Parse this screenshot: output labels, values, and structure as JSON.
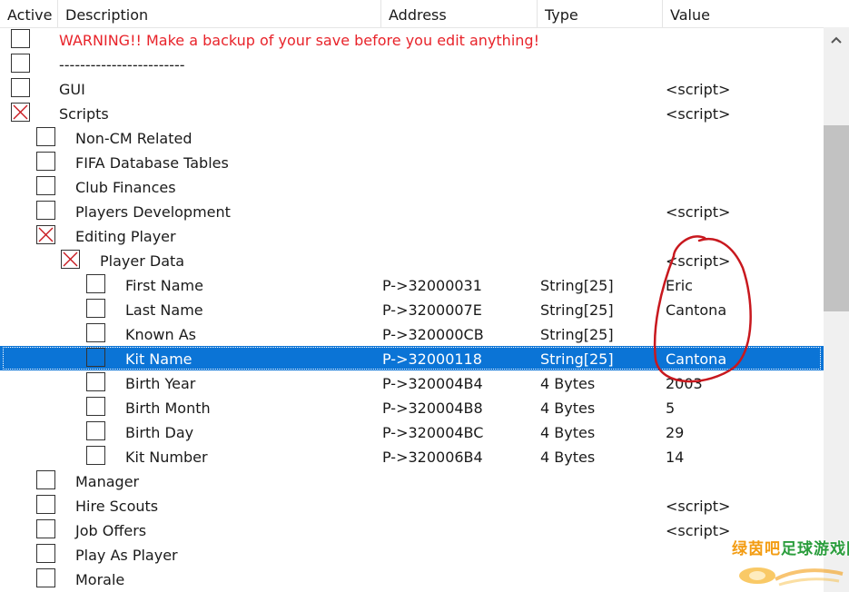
{
  "columns": {
    "active": "Active",
    "description": "Description",
    "address": "Address",
    "type": "Type",
    "value": "Value"
  },
  "rows": [
    {
      "indent": 0,
      "checked": false,
      "desc": "WARNING!! Make a backup of your save before you edit anything!",
      "warning": true,
      "address": "",
      "type": "",
      "value": ""
    },
    {
      "indent": 0,
      "checked": false,
      "desc": "------------------------",
      "address": "",
      "type": "",
      "value": ""
    },
    {
      "indent": 0,
      "checked": false,
      "desc": "GUI",
      "address": "",
      "type": "",
      "value": "<script>"
    },
    {
      "indent": 0,
      "checked": true,
      "desc": "Scripts",
      "address": "",
      "type": "",
      "value": "<script>"
    },
    {
      "indent": 1,
      "checked": false,
      "desc": "Non-CM Related",
      "address": "",
      "type": "",
      "value": ""
    },
    {
      "indent": 1,
      "checked": false,
      "desc": "FIFA Database Tables",
      "address": "",
      "type": "",
      "value": ""
    },
    {
      "indent": 1,
      "checked": false,
      "desc": "Club Finances",
      "address": "",
      "type": "",
      "value": ""
    },
    {
      "indent": 1,
      "checked": false,
      "desc": "Players Development",
      "address": "",
      "type": "",
      "value": "<script>"
    },
    {
      "indent": 1,
      "checked": true,
      "desc": "Editing Player",
      "address": "",
      "type": "",
      "value": ""
    },
    {
      "indent": 2,
      "checked": true,
      "desc": "Player Data",
      "address": "",
      "type": "",
      "value": "<script>"
    },
    {
      "indent": 3,
      "checked": false,
      "desc": "First Name",
      "address": "P->32000031",
      "type": "String[25]",
      "value": "Eric"
    },
    {
      "indent": 3,
      "checked": false,
      "desc": "Last Name",
      "address": "P->3200007E",
      "type": "String[25]",
      "value": "Cantona"
    },
    {
      "indent": 3,
      "checked": false,
      "desc": "Known As",
      "address": "P->320000CB",
      "type": "String[25]",
      "value": ""
    },
    {
      "indent": 3,
      "checked": false,
      "desc": "Kit Name",
      "address": "P->32000118",
      "type": "String[25]",
      "value": "Cantona",
      "selected": true
    },
    {
      "indent": 3,
      "checked": false,
      "desc": "Birth Year",
      "address": "P->320004B4",
      "type": "4 Bytes",
      "value": "2003"
    },
    {
      "indent": 3,
      "checked": false,
      "desc": "Birth Month",
      "address": "P->320004B8",
      "type": "4 Bytes",
      "value": "5"
    },
    {
      "indent": 3,
      "checked": false,
      "desc": "Birth Day",
      "address": "P->320004BC",
      "type": "4 Bytes",
      "value": "29"
    },
    {
      "indent": 3,
      "checked": false,
      "desc": "Kit Number",
      "address": "P->320006B4",
      "type": "4 Bytes",
      "value": "14"
    },
    {
      "indent": 1,
      "checked": false,
      "desc": "Manager",
      "address": "",
      "type": "",
      "value": ""
    },
    {
      "indent": 1,
      "checked": false,
      "desc": "Hire Scouts",
      "address": "",
      "type": "",
      "value": "<script>"
    },
    {
      "indent": 1,
      "checked": false,
      "desc": "Job Offers",
      "address": "",
      "type": "",
      "value": "<script>"
    },
    {
      "indent": 1,
      "checked": false,
      "desc": "Play As Player",
      "address": "",
      "type": "",
      "value": ""
    },
    {
      "indent": 1,
      "checked": false,
      "desc": "Morale",
      "address": "",
      "type": "",
      "value": ""
    }
  ],
  "watermark": {
    "part1": "绿茵吧",
    "part2": "足球游戏网"
  },
  "colors": {
    "selection": "#0b74d6",
    "warning": "#e8232a",
    "annotation": "#c8181e"
  },
  "icons": {
    "scroll_up": "chevron-up-icon",
    "checked": "cross-check-icon"
  }
}
